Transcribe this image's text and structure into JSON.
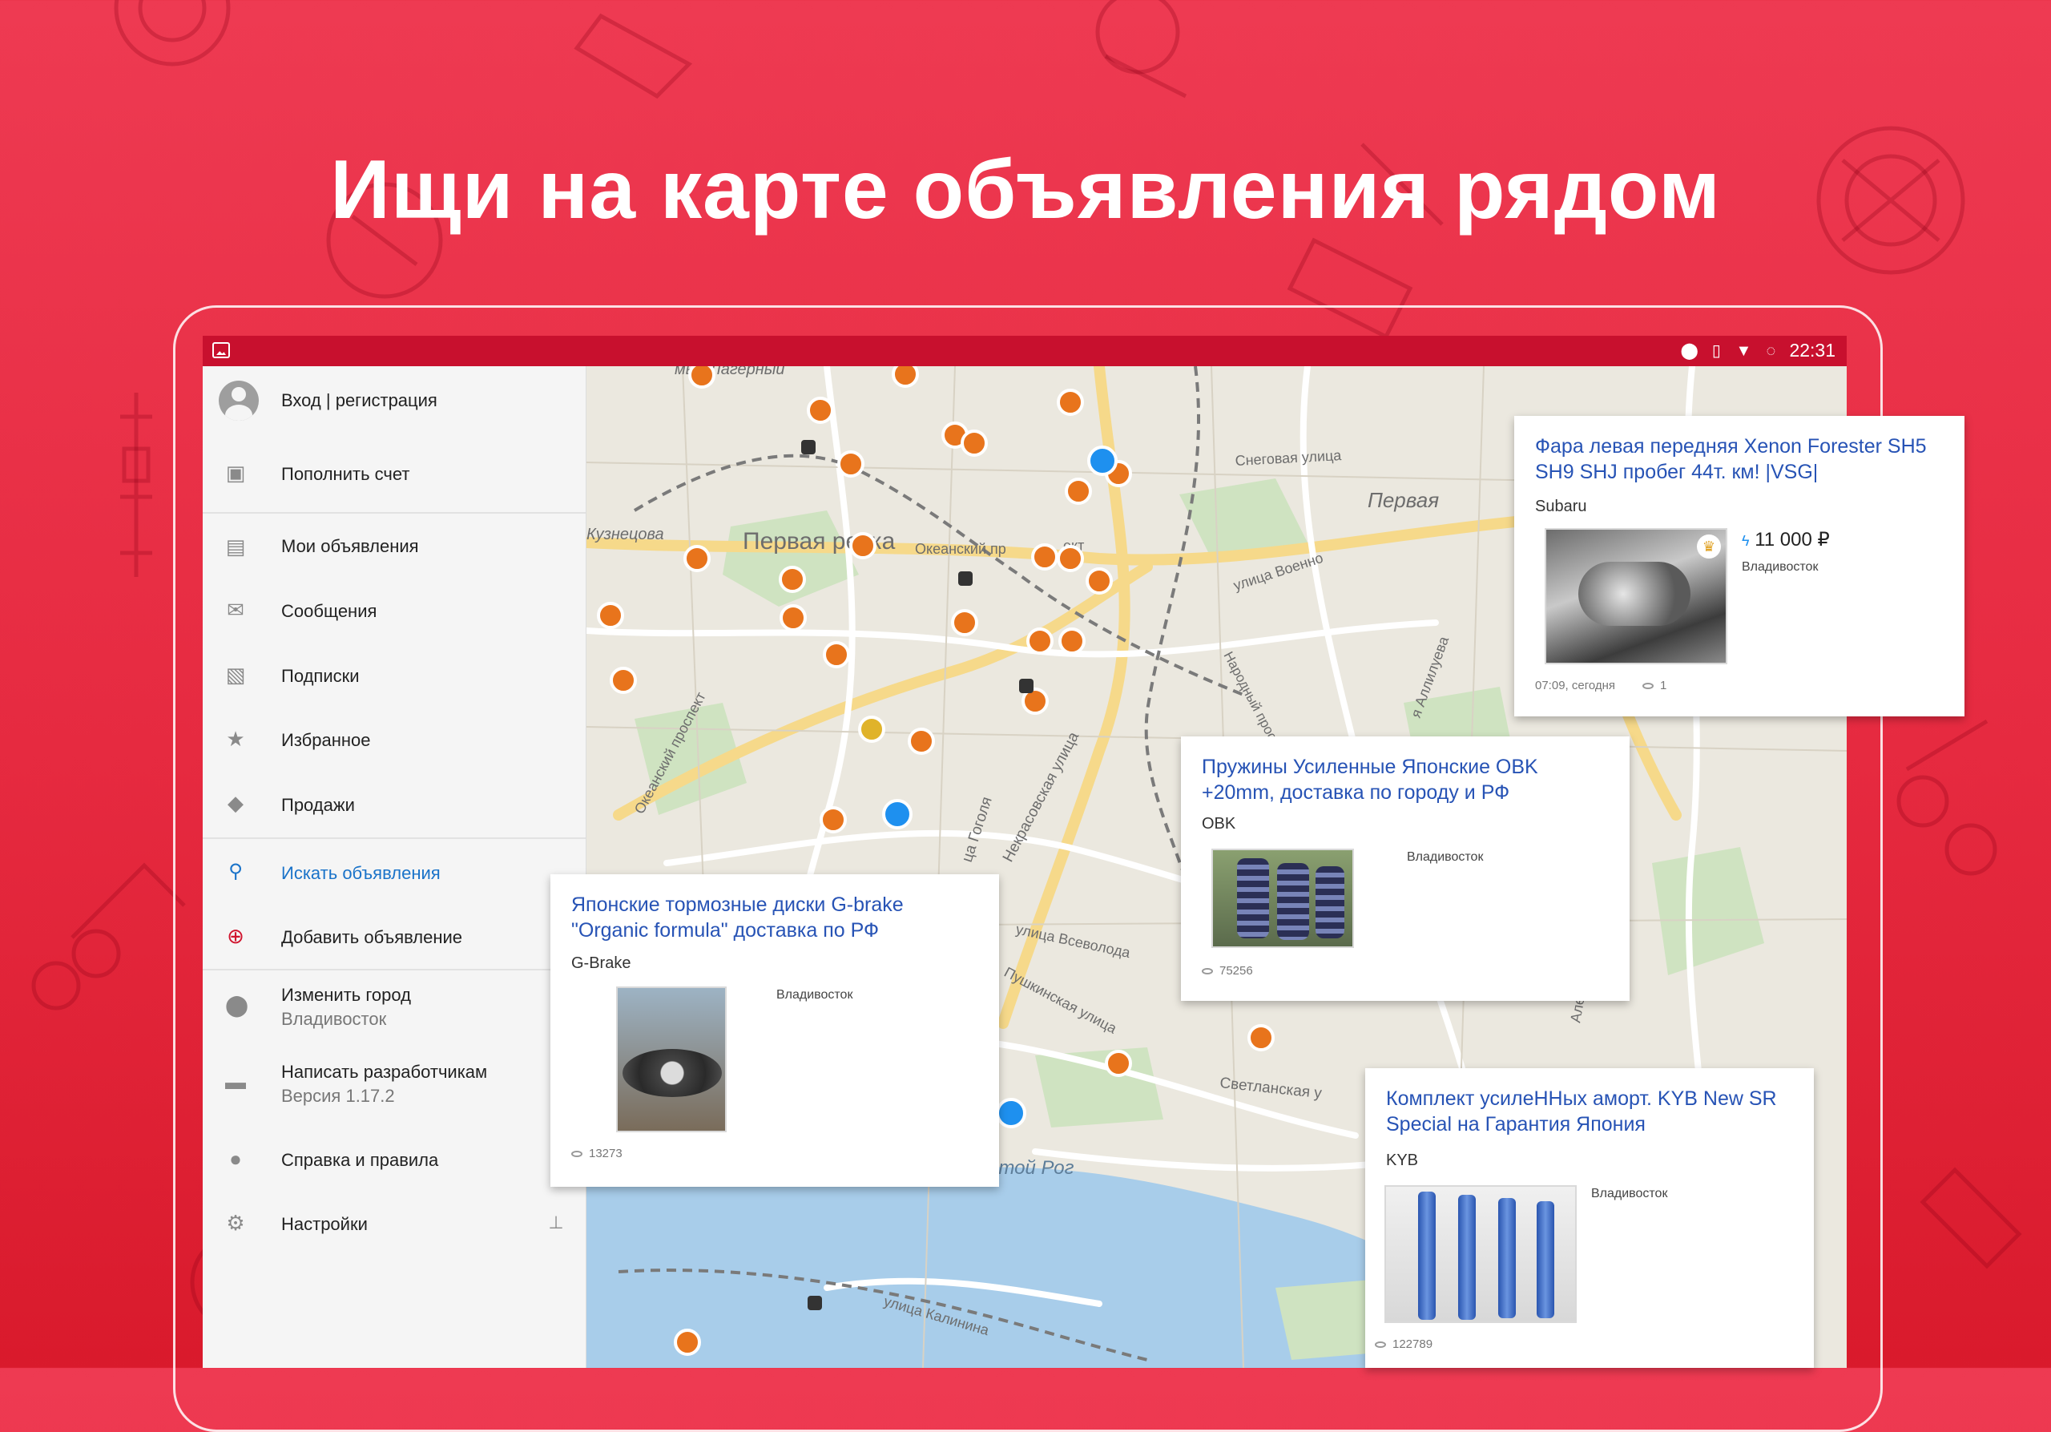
{
  "headline": "Ищи на карте объявления рядом",
  "status_bar": {
    "time": "22:31"
  },
  "drawer": {
    "account": "Вход | регистрация",
    "items": [
      {
        "label": "Пополнить счет",
        "icon": "wallet-icon"
      },
      {
        "label": "Мои объявления",
        "icon": "clipboard-icon"
      },
      {
        "label": "Сообщения",
        "icon": "mail-icon"
      },
      {
        "label": "Подписки",
        "icon": "subscription-icon"
      },
      {
        "label": "Избранное",
        "icon": "star-icon"
      },
      {
        "label": "Продажи",
        "icon": "tag-icon"
      },
      {
        "label": "Искать объявления",
        "icon": "search-icon"
      },
      {
        "label": "Добавить объявление",
        "icon": "add-circle-icon"
      }
    ],
    "city": {
      "label": "Изменить город",
      "value": "Владивосток"
    },
    "feedback": {
      "label": "Написать разработчикам",
      "version": "Версия 1.17.2"
    },
    "help": "Справка и правила",
    "settings": "Настройки",
    "accent_color": "#1a73c9",
    "active_item": "Искать объявления"
  },
  "map": {
    "labels": {
      "cape": "мыс Лагерный",
      "kuznetsova": "Кузнецова",
      "pervaya_rechka": "Первая речка",
      "okeansky_pr": "Океанский пр",
      "okeansky_pr_end": "ект",
      "snegovaya": "Снеговая улица",
      "pervaya": "Первая",
      "voennoe": "улица Военно",
      "narodny": "Народный проспе",
      "okeansky_prospekt": "Океанский проспект",
      "nekrasovskaya": "Некрасовская улица",
      "gogolya": "ца Гоголя",
      "vsevoloda": "улица Всеволода",
      "pushkinskaya": "Пушкинская улица",
      "svetlanskaya": "Светланская у",
      "zolotoy_rog": "Золотой Рог",
      "kalinina": "улица Калинина",
      "aleutskaya": "Алеутская улица",
      "allilueva": "я Аллилуева"
    },
    "marker_colors": {
      "orange": "#e8741c",
      "blue": "#1e90ef",
      "yellow": "#e0b32a"
    }
  },
  "listings": [
    {
      "title": "Фара левая передняя Xenon Forester SH5 SH9 SHJ пробег 44т. км! |VSG|",
      "brand": "Subaru",
      "price": "11 000 ₽",
      "city": "Владивосток",
      "time": "07:09, сегодня",
      "views": "1"
    },
    {
      "title": "Пружины Усиленные Японские OBK +20mm, доставка по городу и РФ",
      "brand": "OBK",
      "city": "Владивосток",
      "views": "75256"
    },
    {
      "title": "Японские тормозные диски G-brake \"Organic formula\" доставка по РФ",
      "brand": "G-Brake",
      "city": "Владивосток",
      "views": "13273"
    },
    {
      "title": "Комплект усилеННых аморт. KYB New SR Special на Гарантия Япония",
      "brand": "KYB",
      "city": "Владивосток",
      "views": "122789"
    }
  ],
  "colors": {
    "background": "#e62a40",
    "status_bar": "#c8102e",
    "link": "#2753b5"
  }
}
